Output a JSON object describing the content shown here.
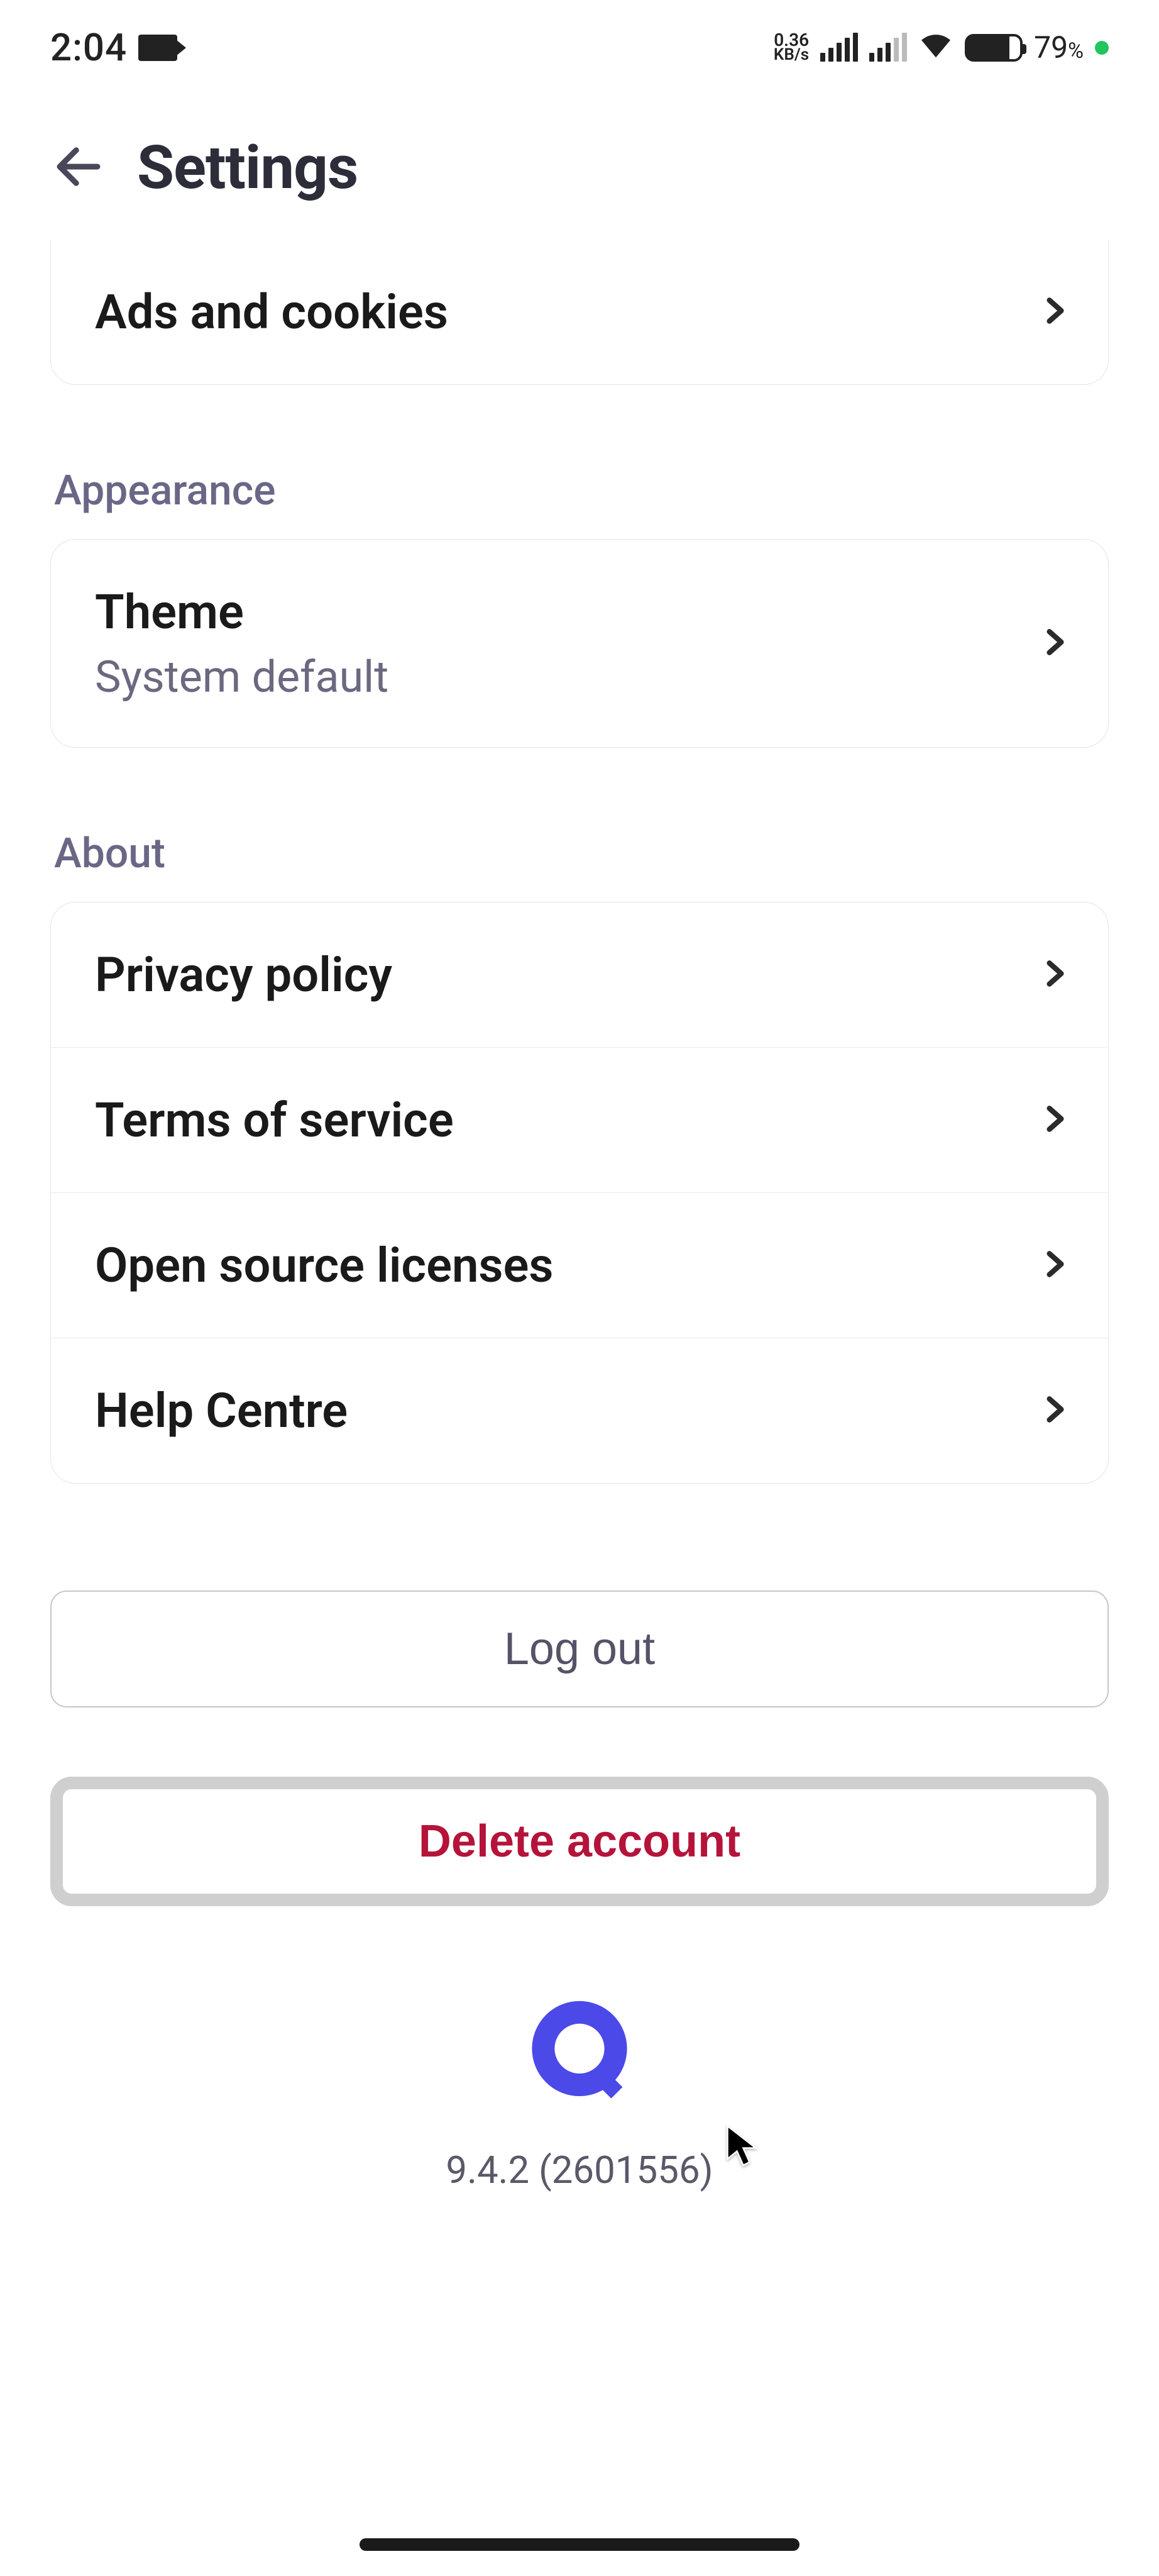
{
  "status_bar": {
    "time": "2:04",
    "net_speed_value": "0.36",
    "net_speed_unit": "KB/s",
    "battery_percent": "79",
    "battery_percent_suffix": "%"
  },
  "header": {
    "title": "Settings"
  },
  "rows": {
    "ads_cookies": "Ads and cookies",
    "theme_title": "Theme",
    "theme_value": "System default",
    "privacy": "Privacy policy",
    "terms": "Terms of service",
    "licenses": "Open source licenses",
    "help": "Help Centre"
  },
  "sections": {
    "appearance": "Appearance",
    "about": "About"
  },
  "buttons": {
    "logout": "Log out",
    "delete": "Delete account"
  },
  "footer": {
    "version": "9.4.2 (2601556)"
  },
  "colors": {
    "accent": "#4b49e8",
    "danger": "#b5133a",
    "muted": "#6a6786"
  }
}
